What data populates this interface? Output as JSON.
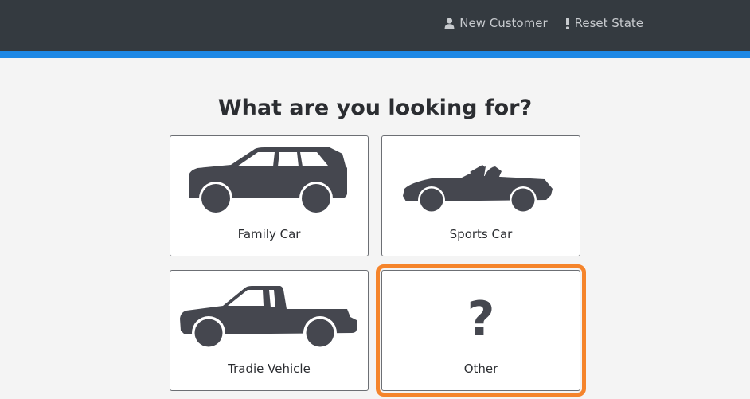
{
  "nav": {
    "new_customer": "New Customer",
    "reset_state": "Reset State"
  },
  "heading": "What are you looking for?",
  "options": [
    {
      "label": "Family Car",
      "icon": "suv-icon",
      "selected": false
    },
    {
      "label": "Sports Car",
      "icon": "convertible-icon",
      "selected": false
    },
    {
      "label": "Tradie Vehicle",
      "icon": "pickup-truck-icon",
      "selected": false
    },
    {
      "label": "Other",
      "icon": "question-mark-icon",
      "glyph": "?",
      "selected": true
    }
  ],
  "colors": {
    "header_bg": "#343a40",
    "accent_bar": "#1e88e5",
    "selection_outline": "#f5842b",
    "vehicle_fill": "#45474f"
  }
}
